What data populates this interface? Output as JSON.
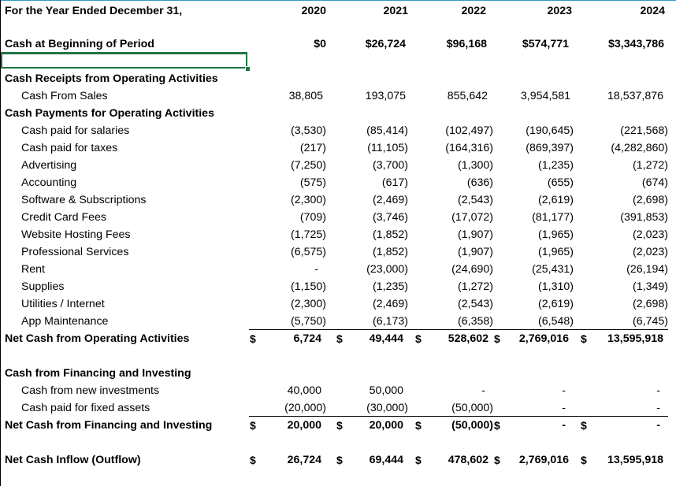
{
  "header": {
    "label": "For the Year Ended December 31,",
    "years": [
      "2020",
      "2021",
      "2022",
      "2023",
      "2024"
    ]
  },
  "beginning": {
    "label": "Cash at Beginning of Period",
    "values": [
      "$0",
      "$26,724",
      "$96,168",
      "$574,771",
      "$3,343,786"
    ]
  },
  "operating": {
    "receipts_heading": "Cash Receipts from Operating Activities",
    "sales": {
      "label": "Cash From Sales",
      "values": [
        "38,805",
        "193,075",
        "855,642",
        "3,954,581",
        "18,537,876"
      ]
    },
    "payments_heading": "Cash Payments for Operating Activities",
    "rows": [
      {
        "label": "Cash paid for salaries",
        "values": [
          "(3,530)",
          "(85,414)",
          "(102,497)",
          "(190,645)",
          "(221,568)"
        ]
      },
      {
        "label": "Cash paid for taxes",
        "values": [
          "(217)",
          "(11,105)",
          "(164,316)",
          "(869,397)",
          "(4,282,860)"
        ]
      },
      {
        "label": "Advertising",
        "values": [
          "(7,250)",
          "(3,700)",
          "(1,300)",
          "(1,235)",
          "(1,272)"
        ]
      },
      {
        "label": "Accounting",
        "values": [
          "(575)",
          "(617)",
          "(636)",
          "(655)",
          "(674)"
        ]
      },
      {
        "label": "Software & Subscriptions",
        "values": [
          "(2,300)",
          "(2,469)",
          "(2,543)",
          "(2,619)",
          "(2,698)"
        ]
      },
      {
        "label": "Credit Card Fees",
        "values": [
          "(709)",
          "(3,746)",
          "(17,072)",
          "(81,177)",
          "(391,853)"
        ]
      },
      {
        "label": "Website Hosting Fees",
        "values": [
          "(1,725)",
          "(1,852)",
          "(1,907)",
          "(1,965)",
          "(2,023)"
        ]
      },
      {
        "label": "Professional Services",
        "values": [
          "(6,575)",
          "(1,852)",
          "(1,907)",
          "(1,965)",
          "(2,023)"
        ]
      },
      {
        "label": "Rent",
        "values": [
          "-",
          "(23,000)",
          "(24,690)",
          "(25,431)",
          "(26,194)"
        ]
      },
      {
        "label": "Supplies",
        "values": [
          "(1,150)",
          "(1,235)",
          "(1,272)",
          "(1,310)",
          "(1,349)"
        ]
      },
      {
        "label": "Utilities / Internet",
        "values": [
          "(2,300)",
          "(2,469)",
          "(2,543)",
          "(2,619)",
          "(2,698)"
        ]
      },
      {
        "label": "App Maintenance",
        "values": [
          "(5,750)",
          "(6,173)",
          "(6,358)",
          "(6,548)",
          "(6,745)"
        ]
      }
    ],
    "net": {
      "label": "Net Cash from Operating Activities",
      "currency": "$",
      "values": [
        "6,724",
        "49,444",
        "528,602",
        "2,769,016",
        "13,595,918"
      ]
    }
  },
  "financing": {
    "heading": "Cash from Financing and Investing",
    "rows": [
      {
        "label": "Cash from new investments",
        "values": [
          "40,000",
          "50,000",
          "-",
          "-",
          "-"
        ]
      },
      {
        "label": "Cash paid for fixed assets",
        "values": [
          "(20,000)",
          "(30,000)",
          "(50,000)",
          "-",
          "-"
        ]
      }
    ],
    "net": {
      "label": "Net Cash from Financing and Investing",
      "currency": "$",
      "values": [
        "20,000",
        "20,000",
        "(50,000)",
        "-",
        "-"
      ]
    }
  },
  "inflow": {
    "label": "Net Cash Inflow (Outflow)",
    "currency": "$",
    "values": [
      "26,724",
      "69,444",
      "478,602",
      "2,769,016",
      "13,595,918"
    ]
  }
}
